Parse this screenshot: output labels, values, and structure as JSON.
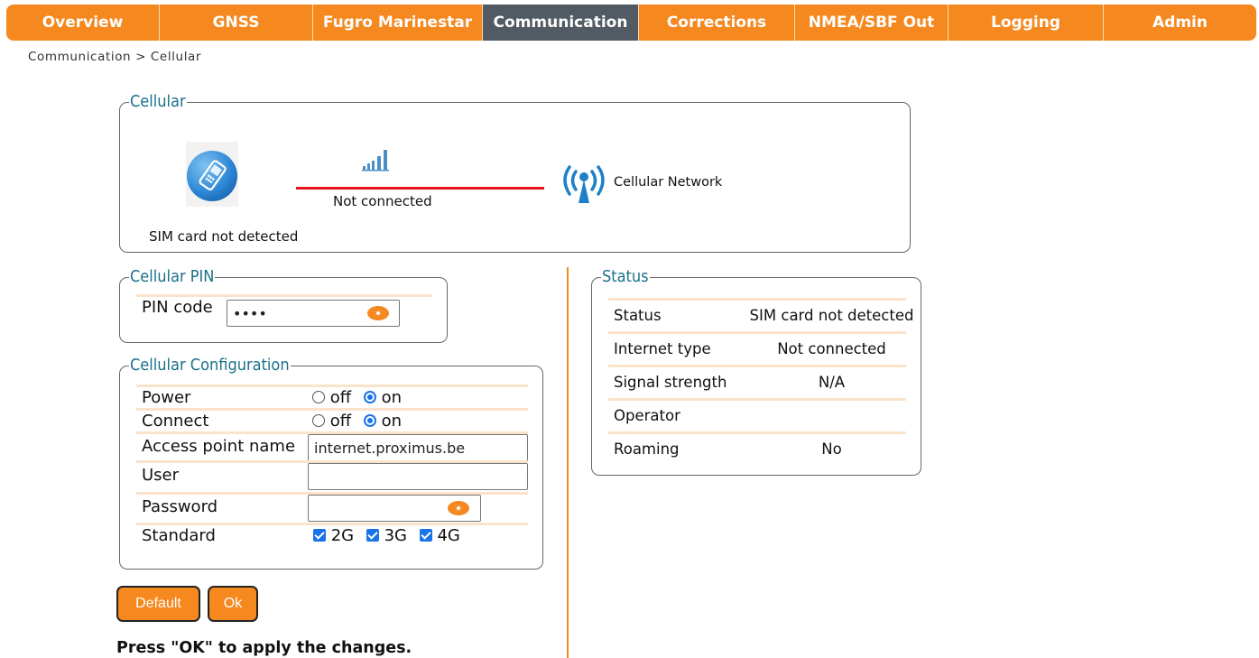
{
  "nav": {
    "tabs": [
      {
        "label": "Overview",
        "active": false
      },
      {
        "label": "GNSS",
        "active": false
      },
      {
        "label": "Fugro Marinestar",
        "active": false
      },
      {
        "label": "Communication",
        "active": true
      },
      {
        "label": "Corrections",
        "active": false
      },
      {
        "label": "NMEA/SBF Out",
        "active": false
      },
      {
        "label": "Logging",
        "active": false
      },
      {
        "label": "Admin",
        "active": false
      }
    ]
  },
  "breadcrumb": "Communication > Cellular",
  "cellular": {
    "legend": "Cellular",
    "sim_status": "SIM card not detected",
    "connection_status": "Not connected",
    "network_label": "Cellular Network"
  },
  "pin": {
    "legend": "Cellular PIN",
    "label": "PIN code",
    "value": "••••"
  },
  "config": {
    "legend": "Cellular Configuration",
    "power": {
      "label": "Power",
      "off": "off",
      "on": "on",
      "selected": "on"
    },
    "connect": {
      "label": "Connect",
      "off": "off",
      "on": "on",
      "selected": "on"
    },
    "apn": {
      "label": "Access point name",
      "value": "internet.proximus.be"
    },
    "user": {
      "label": "User",
      "value": ""
    },
    "password": {
      "label": "Password",
      "value": ""
    },
    "standard": {
      "label": "Standard",
      "options": [
        "2G",
        "3G",
        "4G"
      ],
      "checked": [
        true,
        true,
        true
      ]
    }
  },
  "status": {
    "legend": "Status",
    "rows": [
      {
        "label": "Status",
        "value": "SIM card not detected"
      },
      {
        "label": "Internet type",
        "value": "Not connected"
      },
      {
        "label": "Signal strength",
        "value": "N/A"
      },
      {
        "label": "Operator",
        "value": ""
      },
      {
        "label": "Roaming",
        "value": "No"
      }
    ]
  },
  "buttons": {
    "default": "Default",
    "ok": "Ok"
  },
  "hint": "Press \"OK\" to apply the changes.",
  "colors": {
    "accent": "#f5881f",
    "active_tab": "#525a63",
    "legend": "#1a7089",
    "link_line": "#e8141c",
    "checkbox": "#1a73e8"
  }
}
